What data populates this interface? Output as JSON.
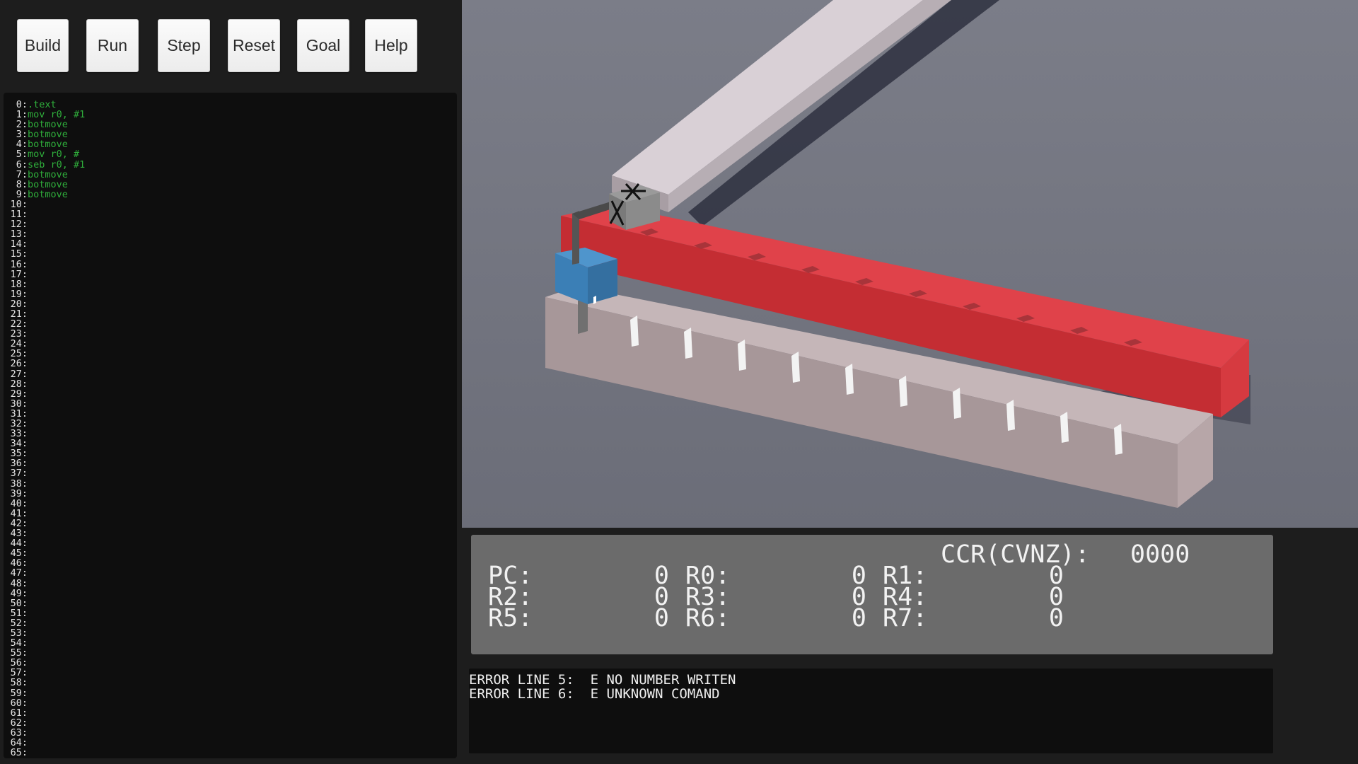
{
  "toolbar": {
    "build_label": "Build",
    "run_label": "Run",
    "step_label": "Step",
    "reset_label": "Reset",
    "goal_label": "Goal",
    "help_label": "Help"
  },
  "editor": {
    "line_count": 66,
    "lines": [
      ".text",
      "mov r0, #1",
      "botmove",
      "botmove",
      "botmove",
      "mov r0, #",
      "seb r0, #1",
      "botmove",
      "botmove",
      "botmove"
    ]
  },
  "registers": {
    "ccr_label": "CCR(CVNZ):",
    "ccr_value": "0000",
    "rows": [
      [
        {
          "label": "PC:",
          "value": "0"
        },
        {
          "label": "R0:",
          "value": "0"
        },
        {
          "label": "R1:",
          "value": "0"
        }
      ],
      [
        {
          "label": "R2:",
          "value": "0"
        },
        {
          "label": "R3:",
          "value": "0"
        },
        {
          "label": "R4:",
          "value": "0"
        }
      ],
      [
        {
          "label": "R5:",
          "value": "0"
        },
        {
          "label": "R6:",
          "value": "0"
        },
        {
          "label": "R7:",
          "value": "0"
        }
      ]
    ]
  },
  "errors": [
    "ERROR LINE 5:  E NO NUMBER WRITEN",
    "ERROR LINE 6:  E UNKNOWN COMAND"
  ],
  "scene": {
    "cube_marks": "X",
    "track_slots": 10,
    "colors": {
      "background": "#757782",
      "red_rail": "#d8373d",
      "rail_stone": "#cfbcbf",
      "robot": "#3f86bd",
      "cube": "#8a8a8a"
    }
  }
}
